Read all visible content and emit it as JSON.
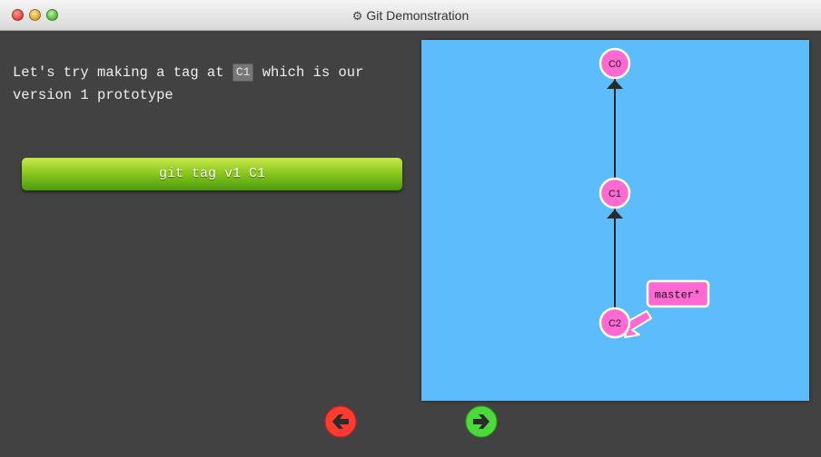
{
  "window": {
    "title": "Git Demonstration",
    "title_icon": "gear-icon"
  },
  "instruction": {
    "before": "Let's try making a tag at ",
    "code": "C1",
    "after": " which is our version 1 prototype"
  },
  "command_button": {
    "label": "git tag v1 C1"
  },
  "graph": {
    "commits": [
      {
        "id": "C0"
      },
      {
        "id": "C1"
      },
      {
        "id": "C2"
      }
    ],
    "branch": {
      "label": "master*"
    }
  },
  "navigation": {
    "prev_icon": "arrow-left-icon",
    "next_icon": "arrow-right-icon"
  },
  "colors": {
    "canvas_bg": "#5cbcfc",
    "commit_fill": "#ff69d2",
    "branch_fill": "#ff69d2",
    "command_button": "#8dc91f",
    "prev_button": "#ff3b30",
    "next_button": "#4cd93a"
  }
}
